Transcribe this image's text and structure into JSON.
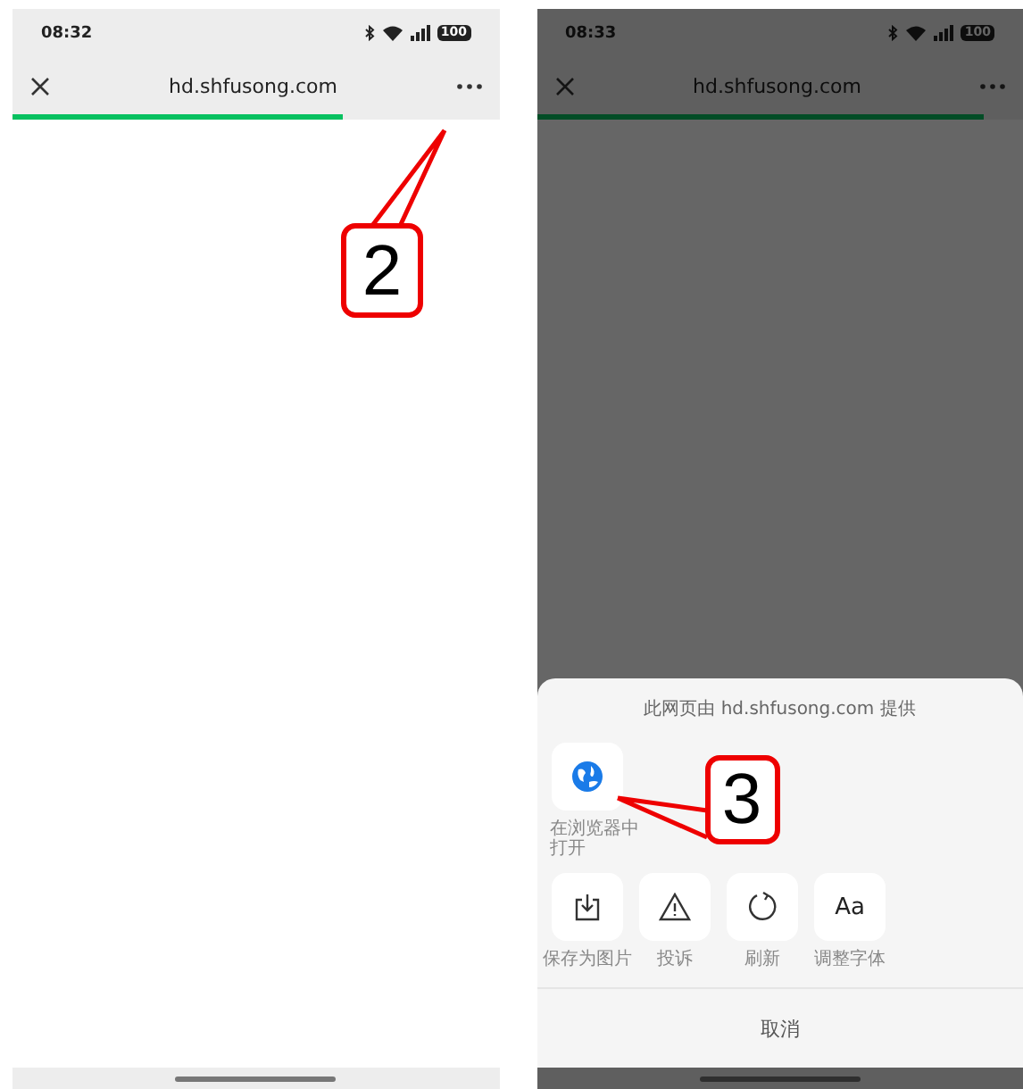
{
  "screens": [
    {
      "status_bar": {
        "time": "08:32",
        "battery": "100"
      },
      "toolbar": {
        "url": "hd.shfusong.com"
      },
      "progress": {
        "level": 0.68
      },
      "menu_open": false,
      "callout": "2"
    },
    {
      "status_bar": {
        "time": "08:33",
        "battery": "100"
      },
      "toolbar": {
        "url": "hd.shfusong.com"
      },
      "progress": {
        "level": 0.92
      },
      "menu_open": true,
      "callout": "3",
      "sheet": {
        "title": "此网页由 hd.shfusong.com 提供",
        "top_actions": [
          {
            "kind": "browser",
            "label": "在浏览器中打开"
          }
        ],
        "actions": [
          {
            "kind": "save",
            "label": "保存为图片"
          },
          {
            "kind": "report",
            "label": "投诉"
          },
          {
            "kind": "refresh",
            "label": "刷新"
          },
          {
            "kind": "font",
            "glyph": "Aa",
            "label": "调整字体"
          }
        ],
        "cancel": "取消"
      }
    }
  ]
}
